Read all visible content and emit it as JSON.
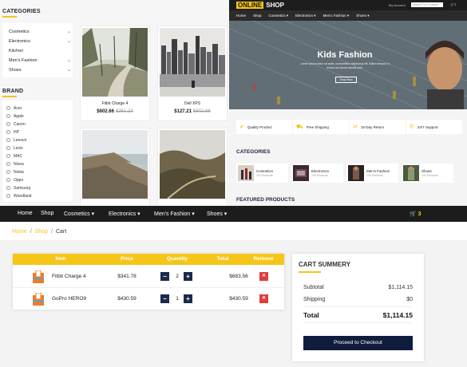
{
  "left": {
    "categories_title": "CATEGORIES",
    "categories": [
      "Cosmetics",
      "Electronics",
      "Kitchen",
      "Men's Fashion",
      "Shoes"
    ],
    "brand_title": "BRAND",
    "brands": [
      "Acer",
      "Apple",
      "Canon",
      "HP",
      "Lenovo",
      "Levis",
      "MAC",
      "Nivea",
      "Nokia",
      "Oppo",
      "Samsung",
      "Woodland"
    ],
    "products": [
      {
        "name": "Fitbit Charge 4",
        "price": "$602.66",
        "old_price": "$251.22"
      },
      {
        "name": "Dell XPS",
        "price": "$127.21",
        "old_price": "$602.66"
      }
    ]
  },
  "shop": {
    "logo_a": "ONLINE",
    "logo_b": "SHOP",
    "my_account": "My Account",
    "search_placeholder": "Search For Products",
    "cart_count": "3",
    "nav": [
      "Home",
      "Shop",
      "Cosmetics ▾",
      "Electronics ▾",
      "Men's Fashion ▾",
      "Shoes ▾"
    ],
    "hero_title": "Kids Fashion",
    "hero_sub": "Lorem ipsum dolor sit amet, consectetur adipiscing elit. Etiam tempus ut lectus non ipsum iaculis quis.",
    "hero_button": "Shop Now",
    "features": [
      "Quality Product",
      "Free Shipping",
      "15-Day Return",
      "24/7 Support"
    ],
    "categories_title": "CATEGORIES",
    "categories": [
      {
        "name": "Cosmetics",
        "count": "100 Products"
      },
      {
        "name": "Electronics",
        "count": "100 Products"
      },
      {
        "name": "Men's Fashion",
        "count": "100 Products"
      },
      {
        "name": "Shoes",
        "count": "100 Products"
      }
    ],
    "featured_title": "FEATURED PRODUCTS"
  },
  "nav": {
    "items": [
      "Home",
      "Shop",
      "Cosmetics ▾",
      "Electronics ▾",
      "Men's Fashion ▾",
      "Shoes ▾"
    ],
    "cart_count": "3"
  },
  "breadcrumb": {
    "home": "Home",
    "shop": "Shop",
    "current": "Cart",
    "sep": "/"
  },
  "cart": {
    "headers": [
      "Item",
      "Price",
      "Quantity",
      "Total",
      "Remove"
    ],
    "rows": [
      {
        "name": "Fitbit Charge 4",
        "price": "$341.78",
        "qty": "2",
        "total": "$683.56"
      },
      {
        "name": "GoPro HERO9",
        "price": "$430.59",
        "qty": "1",
        "total": "$430.59"
      }
    ]
  },
  "summary": {
    "title": "CART SUMMERY",
    "subtotal_label": "Subtotal",
    "subtotal": "$1,114.15",
    "shipping_label": "Shipping",
    "shipping": "$0",
    "total_label": "Total",
    "total": "$1,114.15",
    "checkout": "Proceed to Checkout"
  },
  "colors": {
    "accent": "#f5c518",
    "navy": "#0f1c3d",
    "remove": "#e23b3b",
    "nav_bg": "#1c1c1c"
  }
}
